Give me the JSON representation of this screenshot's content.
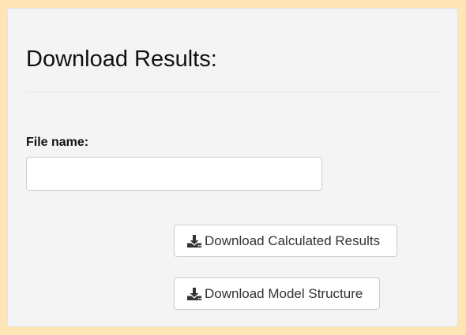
{
  "panel": {
    "title": "Download Results:"
  },
  "form": {
    "file_name_label": "File name:",
    "file_name_value": "",
    "file_name_placeholder": ""
  },
  "buttons": {
    "download_calculated_label": "Download Calculated Results",
    "download_model_label": "Download Model Structure",
    "icon": "download-icon"
  },
  "colors": {
    "page_background": "#ffe4b5",
    "panel_background": "#f4f4f4",
    "button_background": "#ffffff",
    "text": "#333333"
  }
}
